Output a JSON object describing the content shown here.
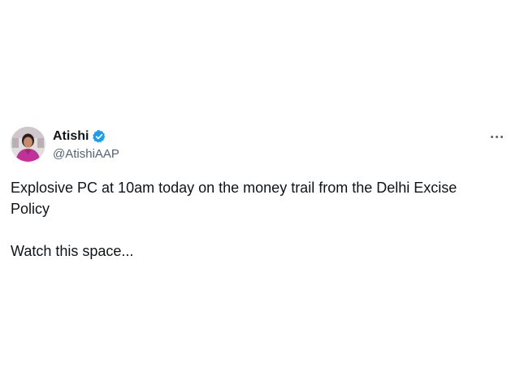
{
  "tweet": {
    "author": {
      "display_name": "Atishi",
      "handle": "@AtishiAAP",
      "verified": true,
      "verified_icon": "verified-badge-icon",
      "avatar_icon": "profile-photo"
    },
    "more_icon": "more-options-icon",
    "text": {
      "line1": "Explosive PC at 10am today on the money trail from the Delhi Excise Policy",
      "line2": "Watch this space..."
    },
    "colors": {
      "text": "#0f1419",
      "secondary": "#536471",
      "verified": "#1d9bf0"
    }
  }
}
